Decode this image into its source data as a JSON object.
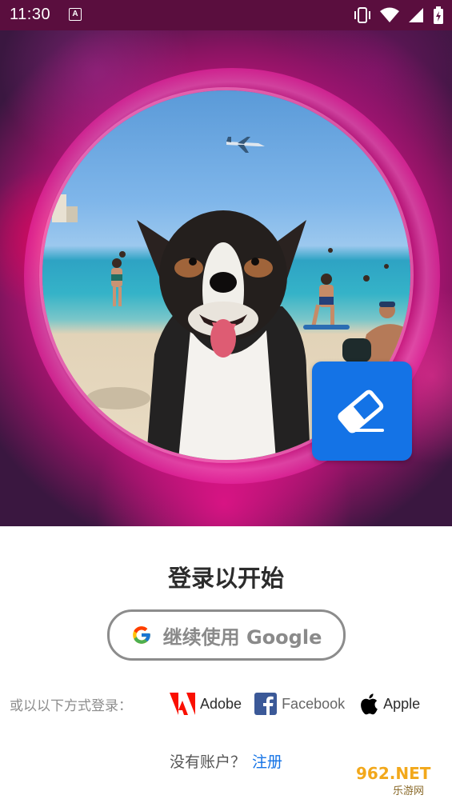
{
  "status_bar": {
    "time": "11:30",
    "notification_icon": "A"
  },
  "hero": {
    "badge_icon": "eraser-icon"
  },
  "login": {
    "title": "登录以开始",
    "google_button": "继续使用 Google",
    "alt_label": "或以以下方式登录：",
    "providers": [
      {
        "name": "Adobe",
        "icon": "adobe-logo-icon"
      },
      {
        "name": "Facebook",
        "icon": "facebook-logo-icon"
      },
      {
        "name": "Apple",
        "icon": "apple-logo-icon"
      }
    ],
    "signup_prompt": "没有账户？",
    "signup_link": "注册"
  },
  "watermark": {
    "text": "962.NET",
    "subtext": "乐游网"
  },
  "colors": {
    "accent": "#1473e6",
    "adobe_red": "#fa0f00",
    "facebook_blue": "#3b5998"
  }
}
